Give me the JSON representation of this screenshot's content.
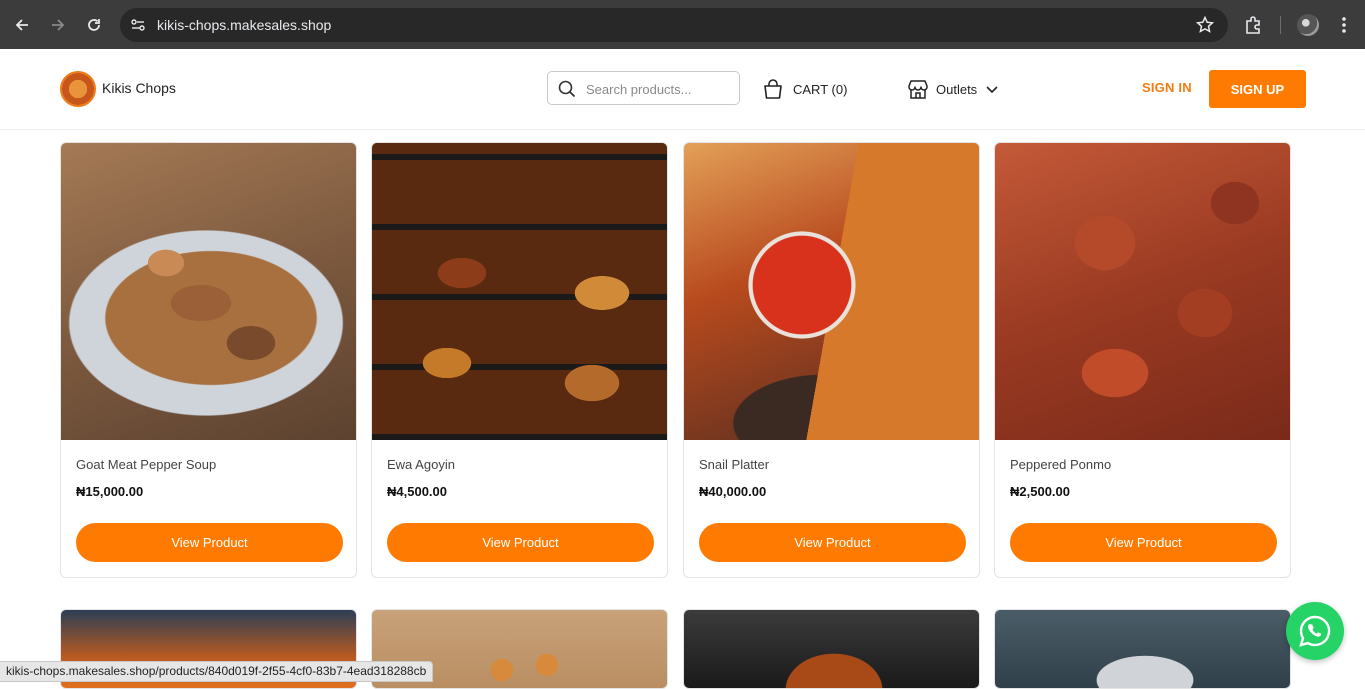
{
  "browser": {
    "url": "kikis-chops.makesales.shop",
    "icons": [
      "back-icon",
      "forward-icon",
      "reload-icon",
      "site-settings-icon",
      "star-icon",
      "extensions-icon",
      "profile-avatar",
      "menu-icon"
    ]
  },
  "header": {
    "brand": "Kikis Chops",
    "search_placeholder": "Search products...",
    "cart_label": "CART (0)",
    "outlets_label": "Outlets",
    "sign_in": "SIGN IN",
    "sign_up": "SIGN UP"
  },
  "colors": {
    "accent": "#ff7a00",
    "chrome_bg": "#3c3c3c",
    "whatsapp": "#25d366"
  },
  "products": [
    {
      "name": "Goat Meat Pepper Soup",
      "price": "₦15,000.00",
      "button": "View Product"
    },
    {
      "name": "Ewa Agoyin",
      "price": "₦4,500.00",
      "button": "View Product"
    },
    {
      "name": "Snail Platter",
      "price": "₦40,000.00",
      "button": "View Product"
    },
    {
      "name": "Peppered Ponmo",
      "price": "₦2,500.00",
      "button": "View Product"
    }
  ],
  "status_url": "kikis-chops.makesales.shop/products/840d019f-2f55-4cf0-83b7-4ead318288cb"
}
